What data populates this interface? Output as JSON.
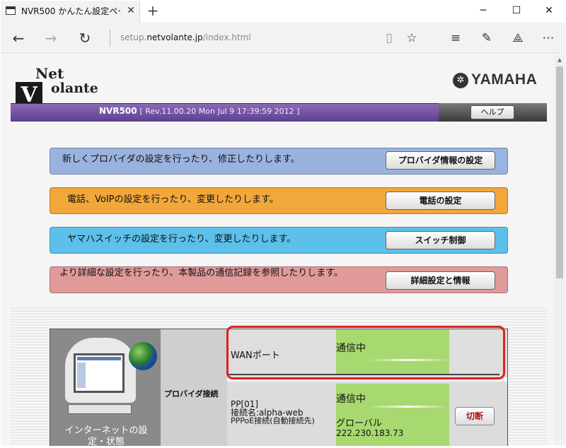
{
  "browser": {
    "tab_title": "NVR500 かんたん設定ペー",
    "url_prefix": "setup.",
    "url_domain": "netvolante.jp",
    "url_path": "/index.html"
  },
  "header": {
    "logo_net": "Net",
    "logo_volante": "olante",
    "logo_v": "V",
    "yamaha": "YAMAHA",
    "model": "NVR500",
    "revision": "[ Rev.11.00.20 Mon Jul 9 17:39:59 2012 ]",
    "help_label": "ヘルプ"
  },
  "menu": [
    {
      "text": "新しくプロバイダの設定を行ったり、修正したりします。",
      "button": "プロバイダ情報の設定",
      "color": "#9ab3de"
    },
    {
      "text": "電話、VoIPの設定を行ったり、変更したりします。",
      "button": "電話の設定",
      "color": "#f2a73a"
    },
    {
      "text": "ヤマハスイッチの設定を行ったり、変更したりします。",
      "button": "スイッチ制御",
      "color": "#5cc0ea"
    },
    {
      "text": "より詳細な設定を行ったり、本製品の通信記録を参照したりします。",
      "button": "詳細設定と情報",
      "color": "#e09a9a"
    }
  ],
  "status": {
    "internet_label": "インターネットの設定・状態",
    "provider_label": "プロバイダ接続",
    "wan_label": "WANポート",
    "wan_status": "通信中",
    "pp_line1": "PP[01]",
    "pp_line2": "接続名:alpha-web",
    "pp_line3": "PPPoE接続(自動接続先)",
    "pp_status": "通信中",
    "pp_global": "グローバル",
    "pp_ip": "222.230.183.73",
    "cut_label": "切断"
  },
  "colors": {
    "banner": "#6b4a9e",
    "connected_green": "#a8d870",
    "highlight": "#e02020"
  }
}
